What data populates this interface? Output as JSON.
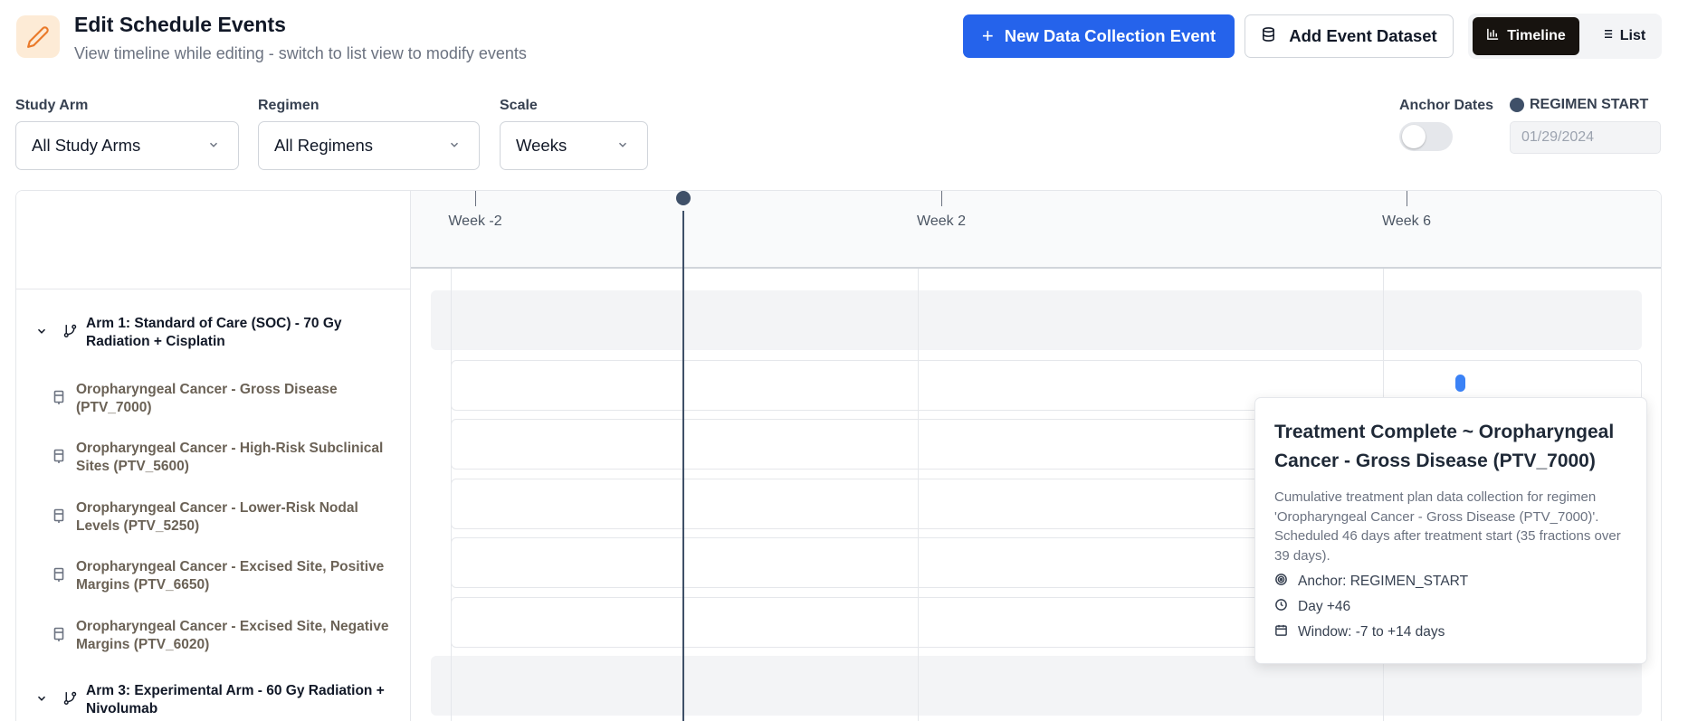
{
  "header": {
    "title": "Edit Schedule Events",
    "subtitle": "View timeline while editing - switch to list view to modify events",
    "icon": "pencil-icon"
  },
  "toolbar": {
    "new_event_label": "New Data Collection Event",
    "add_dataset_label": "Add Event Dataset",
    "timeline_label": "Timeline",
    "list_label": "List",
    "active_view": "Timeline"
  },
  "filters": {
    "study_arm": {
      "label": "Study Arm",
      "value": "All Study Arms"
    },
    "regimen": {
      "label": "Regimen",
      "value": "All Regimens"
    },
    "scale": {
      "label": "Scale",
      "value": "Weeks"
    }
  },
  "anchor": {
    "label": "Anchor Dates",
    "enabled": false,
    "regimen_start_label": "REGIMEN START",
    "date": "01/29/2024",
    "color": "#3f5068"
  },
  "timeline": {
    "ticks": [
      "Week -2",
      "Week 2",
      "Week 6"
    ],
    "arms": [
      {
        "label": "Arm 1: Standard of Care (SOC) - 70 Gy Radiation + Cisplatin",
        "regimens": [
          "Oropharyngeal Cancer - Gross Disease (PTV_7000)",
          "Oropharyngeal Cancer - High-Risk Subclinical Sites (PTV_5600)",
          "Oropharyngeal Cancer - Lower-Risk Nodal Levels (PTV_5250)",
          "Oropharyngeal Cancer - Excised Site, Positive Margins (PTV_6650)",
          "Oropharyngeal Cancer - Excised Site, Negative Margins (PTV_6020)"
        ]
      },
      {
        "label": "Arm 3: Experimental Arm - 60 Gy Radiation + Nivolumab",
        "regimens": []
      }
    ]
  },
  "tooltip": {
    "title": "Treatment Complete ~ Oropharyngeal Cancer - Gross Disease (PTV_7000)",
    "description": "Cumulative treatment plan data collection for regimen 'Oropharyngeal Cancer - Gross Disease (PTV_7000)'. Scheduled 46 days after treatment start (35 fractions over 39 days).",
    "anchor": "Anchor: REGIMEN_START",
    "day": "Day +46",
    "window": "Window: -7 to +14 days"
  },
  "colors": {
    "primary": "#2563eb",
    "event": "#3b82f6",
    "dark_toggle": "#17130f"
  }
}
